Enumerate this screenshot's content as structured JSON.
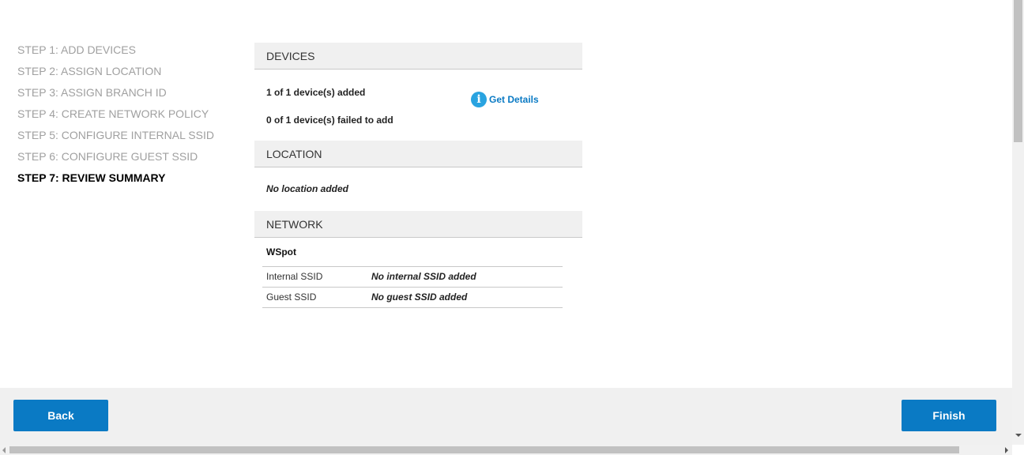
{
  "steps": [
    {
      "label": "STEP 1: ADD DEVICES",
      "active": false
    },
    {
      "label": "STEP 2: ASSIGN LOCATION",
      "active": false
    },
    {
      "label": "STEP 3: ASSIGN BRANCH ID",
      "active": false
    },
    {
      "label": "STEP 4: CREATE NETWORK POLICY",
      "active": false
    },
    {
      "label": "STEP 5: CONFIGURE INTERNAL SSID",
      "active": false
    },
    {
      "label": "STEP 6: CONFIGURE GUEST SSID",
      "active": false
    },
    {
      "label": "STEP 7: REVIEW SUMMARY",
      "active": true
    }
  ],
  "devices": {
    "heading": "DEVICES",
    "added": "1 of 1 device(s) added",
    "failed": "0 of 1 device(s) failed to add",
    "details_icon": "i",
    "details_label": "Get Details"
  },
  "location": {
    "heading": "LOCATION",
    "text": "No location added"
  },
  "network": {
    "heading": "NETWORK",
    "name": "WSpot",
    "rows": [
      {
        "key": "Internal SSID",
        "value": "No internal SSID added"
      },
      {
        "key": "Guest SSID",
        "value": "No guest SSID added"
      }
    ]
  },
  "footer": {
    "back_label": "Back",
    "finish_label": "Finish"
  },
  "colors": {
    "accent": "#0a7ac4",
    "info_icon": "#29a3e0",
    "section_bg": "#f0f0f0",
    "step_inactive": "#a0a0a0"
  }
}
